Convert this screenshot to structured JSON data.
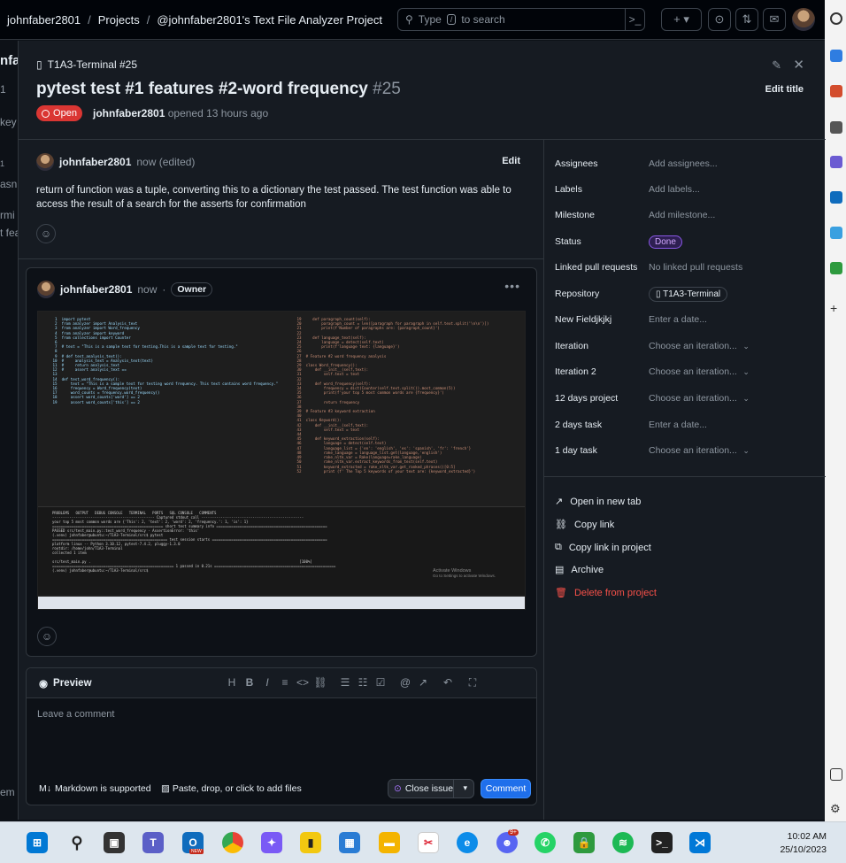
{
  "topbar": {
    "user": "johnfaber2801",
    "projects": "Projects",
    "project_name": "@johnfaber2801's Text File Analyzer Project",
    "search_placeholder_pre": "Type",
    "search_key": "/",
    "search_placeholder_post": "to search"
  },
  "background_left": [
    "nfa",
    "1",
    "key",
    "1",
    "asn'",
    "rmi",
    "t fea",
    "em"
  ],
  "panel": {
    "repo_ref": "T1A3-Terminal #25",
    "title": "pytest test #1 features #2-word frequency",
    "number": "#25",
    "status": "Open",
    "author": "johnfaber2801",
    "opened_text": "opened 13 hours ago",
    "edit_title": "Edit title"
  },
  "comment1": {
    "author": "johnfaber2801",
    "time": "now (edited)",
    "edit": "Edit",
    "body": "return of function was a tuple, converting this to a dictionary the test passed. The test function was able to access the result of a search for the asserts for confirmation"
  },
  "comment2": {
    "author": "johnfaber2801",
    "time": "now",
    "role": "Owner",
    "screenshot_activate_line1": "Activate Windows",
    "screenshot_activate_line2": "Go to Settings to activate Windows."
  },
  "composer": {
    "tab": "Preview",
    "placeholder": "Leave a comment",
    "markdown": "Markdown is supported",
    "paste": "Paste, drop, or click to add files",
    "close_issue": "Close issue",
    "comment": "Comment"
  },
  "fields": [
    {
      "key": "Assignees",
      "value": "Add assignees..."
    },
    {
      "key": "Labels",
      "value": "Add labels..."
    },
    {
      "key": "Milestone",
      "value": "Add milestone..."
    },
    {
      "key": "Status",
      "value": "Done"
    },
    {
      "key": "Linked pull requests",
      "value": "No linked pull requests"
    },
    {
      "key": "Repository",
      "value": "T1A3-Terminal"
    },
    {
      "key": "New Fieldjkjkj",
      "value": "Enter a date..."
    },
    {
      "key": "Iteration",
      "value": "Choose an iteration..."
    },
    {
      "key": "Iteration 2",
      "value": "Choose an iteration..."
    },
    {
      "key": "12 days project",
      "value": "Choose an iteration..."
    },
    {
      "key": "2 days task",
      "value": "Enter a date..."
    },
    {
      "key": "1 day task",
      "value": "Choose an iteration..."
    }
  ],
  "actions": {
    "open_new_tab": "Open in new tab",
    "copy_link": "Copy link",
    "copy_link_project": "Copy link in project",
    "archive": "Archive",
    "delete": "Delete from project"
  },
  "colors": {
    "open_badge": "#da3633",
    "done_badge": "#8957e5",
    "comment_button": "#1f6feb",
    "delete": "#f85149"
  },
  "taskbar": {
    "time": "10:02 AM",
    "date": "25/10/2023",
    "badge_new": "NEW",
    "badge_discord": "9+"
  }
}
